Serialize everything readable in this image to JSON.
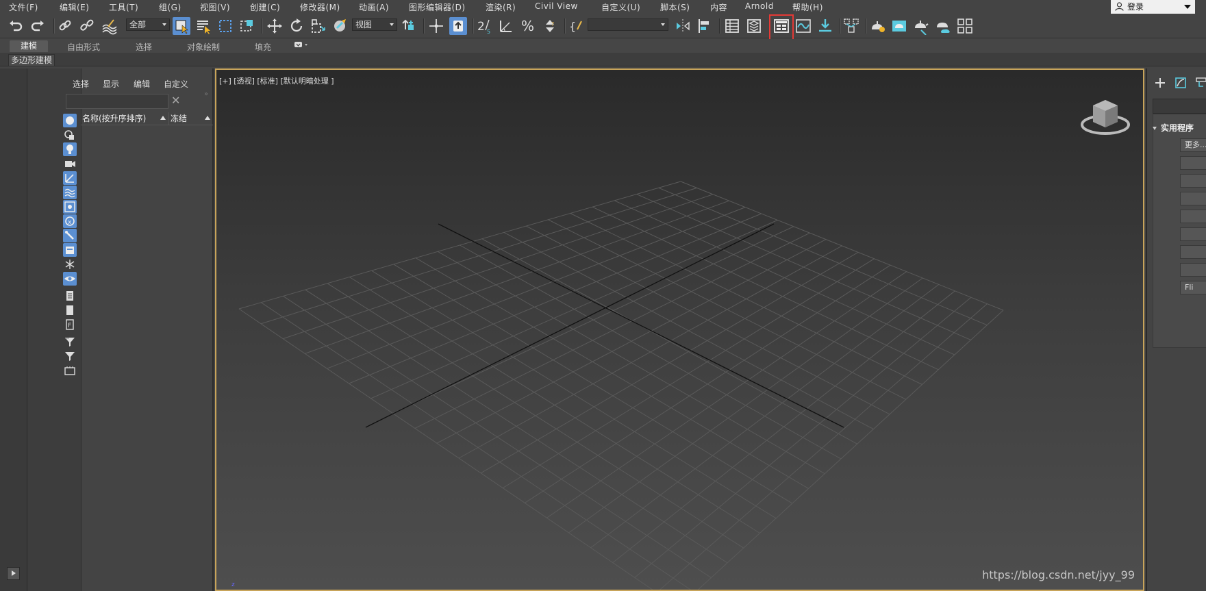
{
  "menubar": {
    "items": [
      "文件(F)",
      "编辑(E)",
      "工具(T)",
      "组(G)",
      "视图(V)",
      "创建(C)",
      "修改器(M)",
      "动画(A)",
      "图形编辑器(D)",
      "渲染(R)",
      "Civil View",
      "自定义(U)",
      "脚本(S)",
      "内容",
      "Arnold",
      "帮助(H)"
    ],
    "login": "登录",
    "login_icon": "user-icon"
  },
  "toolbar": {
    "selection_filter": "全部",
    "reference_coord": "视图",
    "named_selection": "",
    "highlighted_icon": "ribbon-toggle-icon"
  },
  "ribbon": {
    "tabs": [
      "建模",
      "自由形式",
      "选择",
      "对象绘制",
      "填充"
    ],
    "active_tab": "建模",
    "subpanel": "多边形建模"
  },
  "scene_explorer": {
    "tabs": [
      "选择",
      "显示",
      "编辑",
      "自定义"
    ],
    "search_placeholder": "",
    "columns": [
      "名称(按升序排序)",
      "冻结"
    ],
    "filter_icons": [
      "geometry-icon",
      "shapes-icon",
      "lights-icon",
      "cameras-icon",
      "helpers-icon",
      "space-warps-icon",
      "groups-icon",
      "xrefs-icon",
      "bones-icon",
      "containers-icon",
      "frozen-icon",
      "hidden-icon",
      "display-all-icon",
      "display-none-icon",
      "invert-display-icon",
      "filter-selected-icon",
      "filter-icon",
      "layer-icon"
    ]
  },
  "viewport": {
    "label": "[+] [透视] [标准] [默认明暗处理 ]",
    "axis_label": "z"
  },
  "command_panel": {
    "rollout_title": "实用程序",
    "more_button": "更多...",
    "last_button": "Fli"
  },
  "watermark": "https://blog.csdn.net/jyy_99",
  "colors": {
    "accent": "#5b8fd1",
    "highlight": "#e53935",
    "viewport_border": "#c8a45a"
  }
}
